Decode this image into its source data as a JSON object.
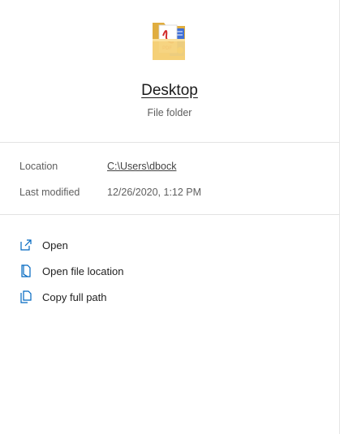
{
  "item": {
    "name": "Desktop",
    "type": "File folder"
  },
  "details": {
    "location_label": "Location",
    "location_value": "C:\\Users\\dbock",
    "modified_label": "Last modified",
    "modified_value": "12/26/2020, 1:12 PM"
  },
  "actions": [
    {
      "label": "Open",
      "icon": "open-external-icon"
    },
    {
      "label": "Open file location",
      "icon": "file-location-icon"
    },
    {
      "label": "Copy full path",
      "icon": "copy-path-icon"
    }
  ],
  "colors": {
    "accent": "#0067c0",
    "folder": "#f2c75c",
    "pdf": "#d12b2b"
  }
}
